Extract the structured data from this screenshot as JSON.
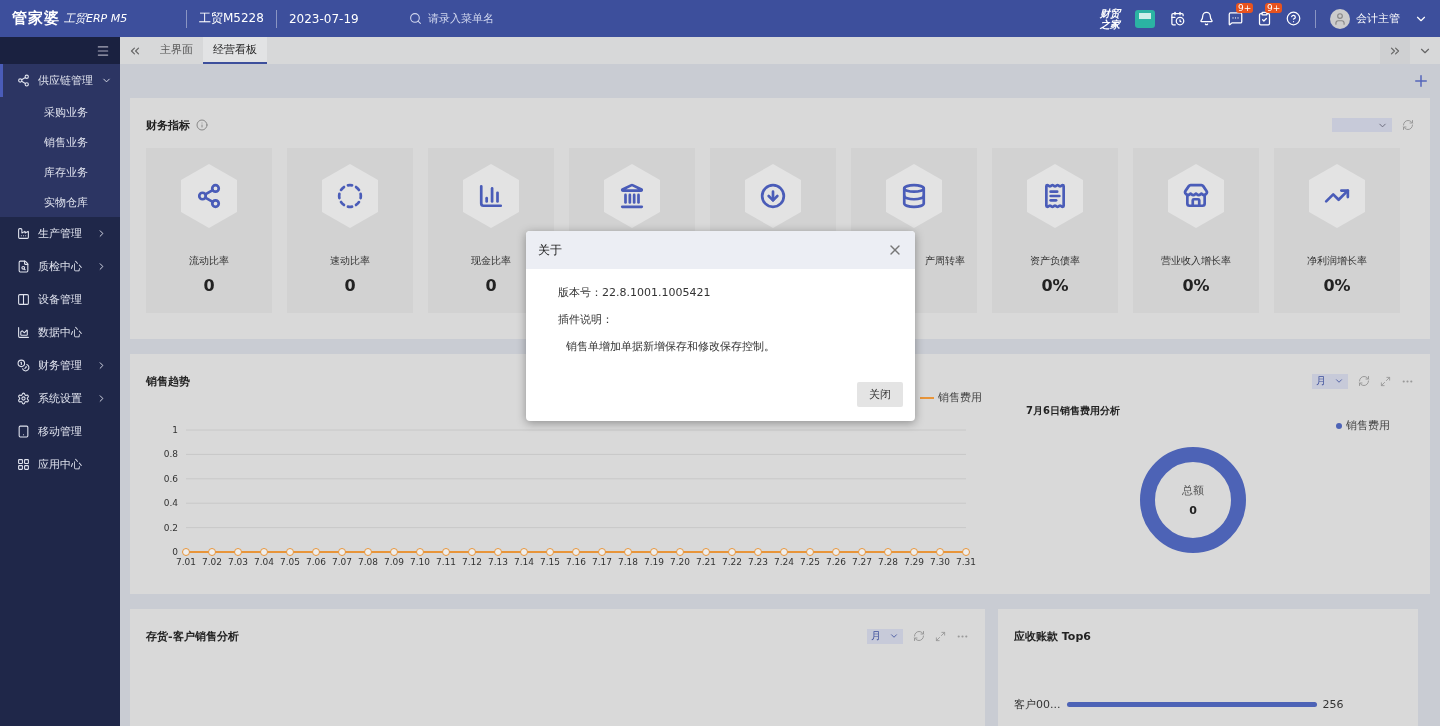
{
  "header": {
    "logo": "管家婆",
    "product": "工贸ERP M5",
    "account": "工贸M5228",
    "date": "2023-07-19",
    "search": {
      "placeholder": "请录入菜单名"
    },
    "brand_text": [
      "财贸",
      "之家"
    ],
    "badges": [
      {
        "kind": "message",
        "count": "9+"
      },
      {
        "kind": "task",
        "count": "9+"
      }
    ],
    "user": "会计主管"
  },
  "tabs": [
    {
      "label": "主界面",
      "selected": false
    },
    {
      "label": "经营看板",
      "selected": true
    }
  ],
  "sidebar": {
    "items": [
      {
        "label": "供应链管理",
        "expanded": true,
        "has_arrow": true,
        "children": [
          {
            "label": "采购业务"
          },
          {
            "label": "销售业务"
          },
          {
            "label": "库存业务"
          },
          {
            "label": "实物仓库"
          }
        ]
      },
      {
        "label": "生产管理",
        "expanded": false,
        "has_arrow": true
      },
      {
        "label": "质检中心",
        "expanded": false,
        "has_arrow": true
      },
      {
        "label": "设备管理",
        "expanded": false,
        "has_arrow": false
      },
      {
        "label": "数据中心",
        "expanded": false,
        "has_arrow": false
      },
      {
        "label": "财务管理",
        "expanded": false,
        "has_arrow": true
      },
      {
        "label": "系统设置",
        "expanded": false,
        "has_arrow": true
      },
      {
        "label": "移动管理",
        "expanded": false,
        "has_arrow": false
      },
      {
        "label": "应用中心",
        "expanded": false,
        "has_arrow": false
      }
    ]
  },
  "finance_panel": {
    "title": "财务指标",
    "cards": [
      {
        "kind": "metric",
        "label": "流动比率",
        "value": "0"
      },
      {
        "kind": "metric",
        "label": "速动比率",
        "value": "0"
      },
      {
        "kind": "metric",
        "label": "现金比率",
        "value": "0"
      },
      {
        "kind": "covered"
      },
      {
        "kind": "covered"
      },
      {
        "kind": "partial",
        "label": "产周转率"
      },
      {
        "kind": "metric",
        "label": "资产负债率",
        "value": "0%"
      },
      {
        "kind": "metric",
        "label": "营业收入增长率",
        "value": "0%"
      },
      {
        "kind": "metric",
        "label": "净利润增长率",
        "value": "0%"
      }
    ]
  },
  "sales_trend": {
    "title": "销售趋势",
    "period": "月",
    "chart_data": {
      "type": "line",
      "x": [
        "7.01",
        "7.02",
        "7.03",
        "7.04",
        "7.05",
        "7.06",
        "7.07",
        "7.08",
        "7.09",
        "7.10",
        "7.11",
        "7.12",
        "7.13",
        "7.14",
        "7.15",
        "7.16",
        "7.17",
        "7.18",
        "7.19",
        "7.20",
        "7.21",
        "7.22",
        "7.23",
        "7.24",
        "7.25",
        "7.26",
        "7.27",
        "7.28",
        "7.29",
        "7.30",
        "7.31"
      ],
      "ylim": [
        0,
        1
      ],
      "yticks": [
        0,
        0.2,
        0.4,
        0.6,
        0.8,
        1
      ],
      "grid": true,
      "series": [
        {
          "name": "销售费用",
          "color": "#e8953a",
          "marker": true,
          "values": [
            0,
            0,
            0,
            0,
            0,
            0,
            0,
            0,
            0,
            0,
            0,
            0,
            0,
            0,
            0,
            0,
            0,
            0,
            0,
            0,
            0,
            0,
            0,
            0,
            0,
            0,
            0,
            0,
            0,
            0,
            0
          ]
        }
      ]
    },
    "donut": {
      "title": "7月6日销售费用分析",
      "legend": "销售费用",
      "center_label": "总额",
      "center_value": "0"
    }
  },
  "inventory_panel": {
    "title": "存货-客户销售分析",
    "period": "月"
  },
  "receivable_panel": {
    "title": "应收账款 Top6",
    "rows": [
      {
        "name": "客户00...",
        "level": 1,
        "value": "256"
      }
    ]
  },
  "dialog": {
    "title": "关于",
    "version": "版本号：22.8.1001.1005421",
    "plugin_label": "插件说明：",
    "plugin_text": "销售单增加单据新增保存和修改保存控制。",
    "button": "关闭"
  }
}
